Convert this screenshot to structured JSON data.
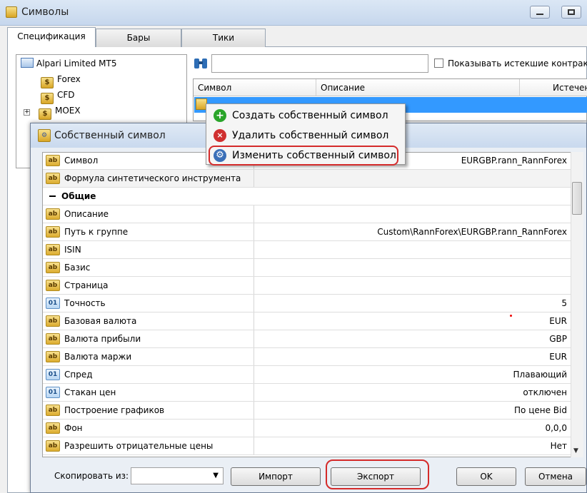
{
  "main_window": {
    "title": "Символы",
    "tabs": [
      "Спецификация",
      "Бары",
      "Тики"
    ],
    "active_tab": "Спецификация"
  },
  "tree": {
    "root": "Alpari Limited MT5",
    "items": [
      "Forex",
      "CFD",
      "MOEX"
    ]
  },
  "search": {
    "value": "",
    "placeholder": ""
  },
  "show_expired": {
    "label": "Показывать истекшие контракты",
    "checked": false
  },
  "symbols_table": {
    "columns": [
      "Символ",
      "Описание",
      "Истечен"
    ]
  },
  "context_menu": {
    "items": [
      {
        "label": "Создать собственный символ",
        "icon": "plus-icon",
        "color": "#2aa52a"
      },
      {
        "label": "Удалить собственный символ",
        "icon": "remove-icon",
        "color": "#d03030"
      },
      {
        "label": "Изменить собственный символ",
        "icon": "gear-icon",
        "color": "#3a6fb8"
      }
    ]
  },
  "dialog": {
    "title": "Собственный символ",
    "properties": [
      {
        "name": "Символ",
        "value": "EURGBP.rann_RannForex",
        "icon": "ab"
      },
      {
        "name": "Формула синтетического инструмента",
        "value": "",
        "icon": "ab"
      },
      {
        "name": "Общие",
        "value": "",
        "group": true
      },
      {
        "name": "Описание",
        "value": "",
        "icon": "ab"
      },
      {
        "name": "Путь к группе",
        "value": "Custom\\RannForex\\EURGBP.rann_RannForex",
        "icon": "ab"
      },
      {
        "name": "ISIN",
        "value": "",
        "icon": "ab"
      },
      {
        "name": "Базис",
        "value": "",
        "icon": "ab"
      },
      {
        "name": "Страница",
        "value": "",
        "icon": "ab"
      },
      {
        "name": "Точность",
        "value": "5",
        "icon": "01"
      },
      {
        "name": "Базовая валюта",
        "value": "EUR",
        "icon": "ab"
      },
      {
        "name": "Валюта прибыли",
        "value": "GBP",
        "icon": "ab"
      },
      {
        "name": "Валюта маржи",
        "value": "EUR",
        "icon": "ab"
      },
      {
        "name": "Спред",
        "value": "Плавающий",
        "icon": "01"
      },
      {
        "name": "Стакан цен",
        "value": "отключен",
        "icon": "01"
      },
      {
        "name": "Построение графиков",
        "value": "По цене Bid",
        "icon": "ab"
      },
      {
        "name": "Фон",
        "value": "0,0,0",
        "icon": "ab"
      },
      {
        "name": "Разрешить отрицательные цены",
        "value": "Нет",
        "icon": "ab"
      }
    ],
    "copy_from_label": "Скопировать из:",
    "copy_from_value": "",
    "buttons": {
      "import": "Импорт",
      "export": "Экспорт",
      "ok": "OK",
      "cancel": "Отмена"
    }
  },
  "icon_texts": {
    "ab": "ab",
    "n01": "01"
  },
  "colors": {
    "selection": "#3399ff",
    "highlight_ring": "#d42a2a"
  }
}
